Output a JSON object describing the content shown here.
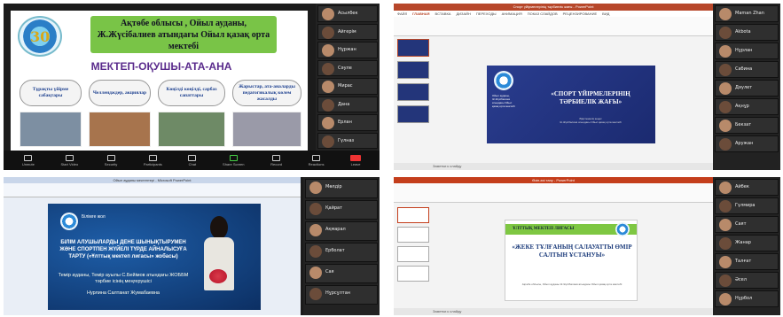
{
  "q1": {
    "logo_num": "30",
    "school_name": "Ақтөбе облысы , Ойыл ауданы, Ж.Жүсібалиев атындағы Ойыл қазақ орта мектебі",
    "motto": "МЕКТЕП-ОҚУШЫ-АТА-АНА",
    "clouds": [
      "Тұрақты үйірме сабақтары",
      "Челлендждер, акциялар",
      "Көңілді көңілді, сарбаз сапаттары",
      "Жарыстар, ата-аналарды педагогикалық көлем жасалды"
    ],
    "zoom_buttons": [
      "Unmute",
      "Start Video",
      "Security",
      "Participants",
      "Chat",
      "Share Screen",
      "Record",
      "Reactions",
      "Leave"
    ],
    "participants": [
      "Асылбек",
      "Айгерім",
      "Нұржан",
      "Сәуле",
      "Мирас",
      "Дана",
      "Ерлан",
      "Гүлназ"
    ]
  },
  "q2": {
    "window_title": "Спорт үйірмелерінің тәрбиелік жағы - PowerPoint",
    "menu": [
      "ФАЙЛ",
      "ГЛАВНАЯ",
      "ВСТАВКА",
      "ДИЗАЙН",
      "ПЕРЕХОДЫ",
      "АНИМАЦИЯ",
      "ПОКАЗ СЛАЙДОВ",
      "РЕЦЕНЗИРОВАНИЕ",
      "ВИД"
    ],
    "slide_title": "«СПОРТ ҮЙІРМЕЛЕРІНІҢ ТӘРБИЕЛІК ЖАҒЫ»",
    "slide_sub": "Әдістемелік кеңес",
    "slide_author": "Ж.Жүсібалиев атындағы Ойыл қазақ орта мектебі",
    "left_text": "Ойыл ауданы, Ж.Жүсібалиев атындағы Ойыл қазақ орта мектебі",
    "status": "Заметки к слайду",
    "participants": [
      "Maman Zhan",
      "Akbota",
      "Нұрлан",
      "Сабина",
      "Дәулет",
      "Ақнұр",
      "Бекзат",
      "Аружан"
    ]
  },
  "q3": {
    "window_title": "Ойыл ауданы мектептері - Microsoft PowerPoint",
    "logo_text": "Білімге жол",
    "body": "БІЛІМ АЛУШЫЛАРДЫ ДЕНЕ ШЫНЫҚТЫРУМЕН ЖӘНЕ СПОРТПЕН ЖҮЙЕЛІ ТҮРДЕ АЙНАЛЫСУҒА ТАРТУ («Ұлттық мектеп лигасы» жобасы)",
    "body2": "Темір ауданы, Темір ауылы С.Бейімов атындағы ЖОББМ тәрбие ісінің меңгерушісі",
    "body3": "Нурлина Салтанат Жумабаевна",
    "participants": [
      "Мөлдір",
      "Қайрат",
      "Ақмарал",
      "Ерболат",
      "Сая",
      "Нұрсұлтан"
    ]
  },
  "q4": {
    "window_title": "Өзін-өзі тану - PowerPoint",
    "band": "ҰЛТТЫҚ МЕКТЕП ЛИГАСЫ",
    "title": "«ЖЕКЕ ТҰЛҒАНЫҢ САЛАУАТТЫ ӨМІР САЛТЫН ҰСТАНУЫ»",
    "sub": "Ақтөбе облысы, Ойыл ауданы Ж.Жүсібалиев атындағы Ойыл қазақ орта мектебі",
    "status": "Заметки к слайду",
    "participants": [
      "Айбек",
      "Гүлмира",
      "Саят",
      "Жанар",
      "Талғат",
      "Әсел",
      "Нұрбол"
    ]
  }
}
